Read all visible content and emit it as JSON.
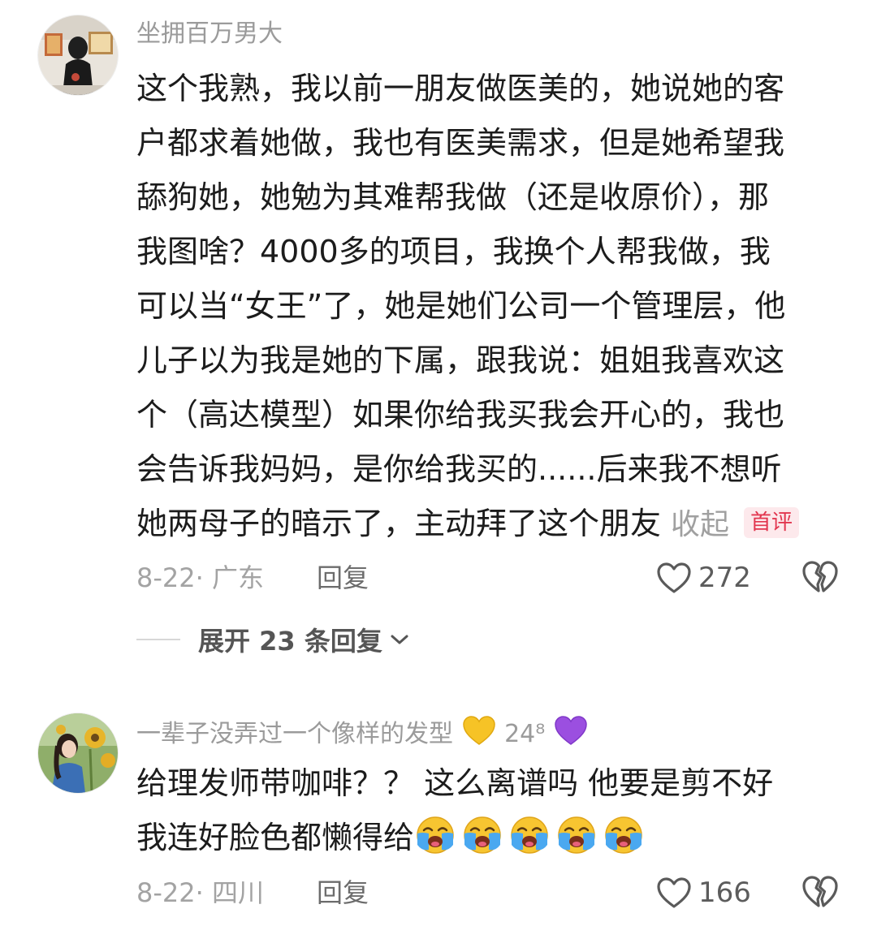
{
  "comments": [
    {
      "username": "坐拥百万男大",
      "lines": [
        "这个我熟，我以前一朋友做医美的，她说她的客",
        "户都求着她做，我也有医美需求，但是她希望我",
        "舔狗她，她勉为其难帮我做（还是收原价），那",
        "我图啥？4000多的项目，我换个人帮我做，我",
        "可以当“女王”了，她是她们公司一个管理层，他",
        "儿子以为我是她的下属，跟我说：姐姐我喜欢这",
        "个（高达模型）如果你给我买我会开心的，我也",
        "会告诉我妈妈，是你给我买的......后来我不想听",
        "她两母子的暗示了，主动拜了这个朋友"
      ],
      "collapse_label": "收起",
      "badge": "首评",
      "meta": "8-22· 广东",
      "reply_label": "回复",
      "likes": "272",
      "expand_label": "展开 23 条回复"
    },
    {
      "username": "一辈子没弄过一个像样的发型",
      "level": "24⁸",
      "lines": [
        "给理发师带咖啡？？ 这么离谱吗  他要是剪不好",
        "我连好脸色都懒得给"
      ],
      "meta": "8-22· 四川",
      "reply_label": "回复",
      "likes": "166"
    }
  ],
  "icons": {
    "like": "heart-outline-icon",
    "dislike": "broken-heart-outline-icon",
    "expand": "chevron-down-icon",
    "emoji_yellow": "yellow-heart-emoji",
    "emoji_purple": "purple-heart-emoji",
    "emoji_cry": "loudly-crying-face-emoji"
  },
  "colors": {
    "badge_text": "#e2364f",
    "badge_bg": "#fde9ec",
    "meta_gray": "#a3a3a3"
  }
}
